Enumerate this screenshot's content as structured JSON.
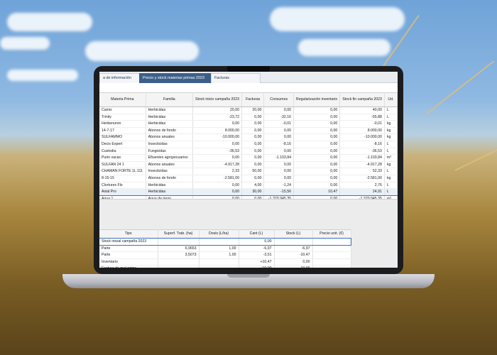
{
  "tabs": [
    {
      "label": "a de información",
      "active": false
    },
    {
      "label": "Precio y stock materias primas 2023",
      "active": true
    },
    {
      "label": "Facturas",
      "active": false
    }
  ],
  "stock_table": {
    "headers": [
      "Materia Prima",
      "Familia",
      "Stock inicio campaña 2023",
      "Facturas",
      "Consumos",
      "Regularización inventario",
      "Stock fin campaña 2023",
      "Ud."
    ],
    "rows": [
      [
        "Camix",
        "Herbicidas",
        "20,00",
        "20,00",
        "0,00",
        "0,00",
        "40,00",
        "L"
      ],
      [
        "Trinity",
        "Herbicidas",
        "-23,72",
        "0,00",
        "-32,16",
        "0,00",
        "-55,88",
        "L"
      ],
      [
        "Herbenuron",
        "Herbicidas",
        "0,00",
        "0,00",
        "-0,01",
        "0,00",
        "-0,01",
        "kg"
      ],
      [
        "14-7-17",
        "Abonos de fondo",
        "8.000,00",
        "0,00",
        "0,00",
        "0,00",
        "8.000,00",
        "kg"
      ],
      [
        "SULFAMMO",
        "Abonos anuales",
        "-10.000,00",
        "0,00",
        "0,00",
        "0,00",
        "-10.000,00",
        "kg"
      ],
      [
        "Decis Expert",
        "Insecticidas",
        "0,00",
        "0,00",
        "-8,16",
        "0,00",
        "-8,16",
        "L"
      ],
      [
        "Custodia",
        "Fungicidas",
        "-36,53",
        "0,00",
        "0,00",
        "0,00",
        "-36,53",
        "L"
      ],
      [
        "Purin vacas",
        "Efluentes agropecuarios",
        "0,00",
        "0,00",
        "-1.103,84",
        "0,00",
        "-1.103,84",
        "m³"
      ],
      [
        "SULFAN 24 1",
        "Abonos anuales",
        "-4.917,28",
        "0,00",
        "0,00",
        "0,00",
        "-4.917,28",
        "kg"
      ],
      [
        "CHAMAN FORTE 1L.111",
        "Insecticidas",
        "2,33",
        "50,00",
        "0,00",
        "0,00",
        "52,33",
        "L"
      ],
      [
        "8-15-15",
        "Abonos de fondo",
        "-2.581,00",
        "0,00",
        "0,00",
        "0,00",
        "-2.581,00",
        "kg"
      ],
      [
        "Clorturex Flo",
        "Herbicidas",
        "0,00",
        "4,00",
        "-1,24",
        "0,00",
        "2,76",
        "L"
      ],
      [
        "Axial Pro",
        "Herbicidas",
        "0,00",
        "30,00",
        "-15,56",
        "10,47",
        "24,91",
        "L"
      ],
      [
        "Agua 1",
        "Agua de riego",
        "0,00",
        "0,00",
        "-1.370.945,35",
        "0,00",
        "-1.370.945,35",
        "m³"
      ]
    ],
    "selected_row": 12
  },
  "detail_table": {
    "headers": [
      "Tipo",
      "Superf. Trab. (ha)",
      "Dosis (L/ha)",
      "Cant (L)",
      "Stock (L)",
      "Precio unit. (€)"
    ],
    "rows": [
      [
        "Stock inicial campaña 2023",
        "",
        "",
        "0,00",
        "",
        ""
      ],
      [
        "Parte",
        "6,9653",
        "1,00",
        "-6,97",
        "-6,97",
        ""
      ],
      [
        "Parte",
        "3,5073",
        "1,00",
        "-3,51",
        "-10,47",
        ""
      ],
      [
        "Inventario",
        "",
        "",
        "+10,47",
        "0,00",
        ""
      ],
      [
        "Factura de mat.prima",
        "",
        "",
        "+10,00",
        "10,00",
        ""
      ]
    ]
  }
}
